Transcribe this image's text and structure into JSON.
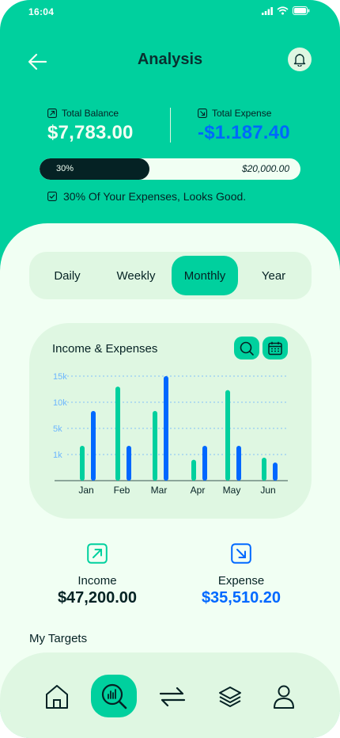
{
  "status": {
    "time": "16:04"
  },
  "header": {
    "title": "Analysis"
  },
  "balance": {
    "label": "Total Balance",
    "value": "$7,783.00"
  },
  "expense": {
    "label": "Total Expense",
    "value": "-$1.187.40"
  },
  "progress": {
    "percent_label": "30%",
    "fraction": 0.3,
    "target": "$20,000.00"
  },
  "note": "30% Of Your Expenses, Looks Good.",
  "tabs": [
    {
      "label": "Daily",
      "active": false
    },
    {
      "label": "Weekly",
      "active": false
    },
    {
      "label": "Monthly",
      "active": true
    },
    {
      "label": "Year",
      "active": false
    }
  ],
  "chart_title": "Income & Expenses",
  "chart_data": {
    "type": "bar",
    "title": "Income & Expenses",
    "categories": [
      "Jan",
      "Feb",
      "Mar",
      "Apr",
      "May",
      "Jun"
    ],
    "y_ticks": [
      "1k",
      "5k",
      "10k",
      "15k"
    ],
    "series": [
      {
        "color": "#00D09E",
        "values": [
          5000,
          13500,
          10000,
          3000,
          13000,
          3300
        ]
      },
      {
        "color": "#0068FF",
        "values": [
          10000,
          5000,
          15000,
          5000,
          5000,
          2600
        ]
      }
    ],
    "grid": true
  },
  "summary": {
    "income": {
      "label": "Income",
      "value": "$47,200.00"
    },
    "expense": {
      "label": "Expense",
      "value": "$35,510.20"
    }
  },
  "targets_label": "My Targets",
  "nav": [
    "home-icon",
    "analysis-icon",
    "transactions-icon",
    "categories-icon",
    "profile-icon"
  ],
  "colors": {
    "primary": "#00D09E",
    "blue": "#0068FF",
    "dark": "#052224",
    "light": "#F1FFF3",
    "pale": "#DFF7E2"
  }
}
